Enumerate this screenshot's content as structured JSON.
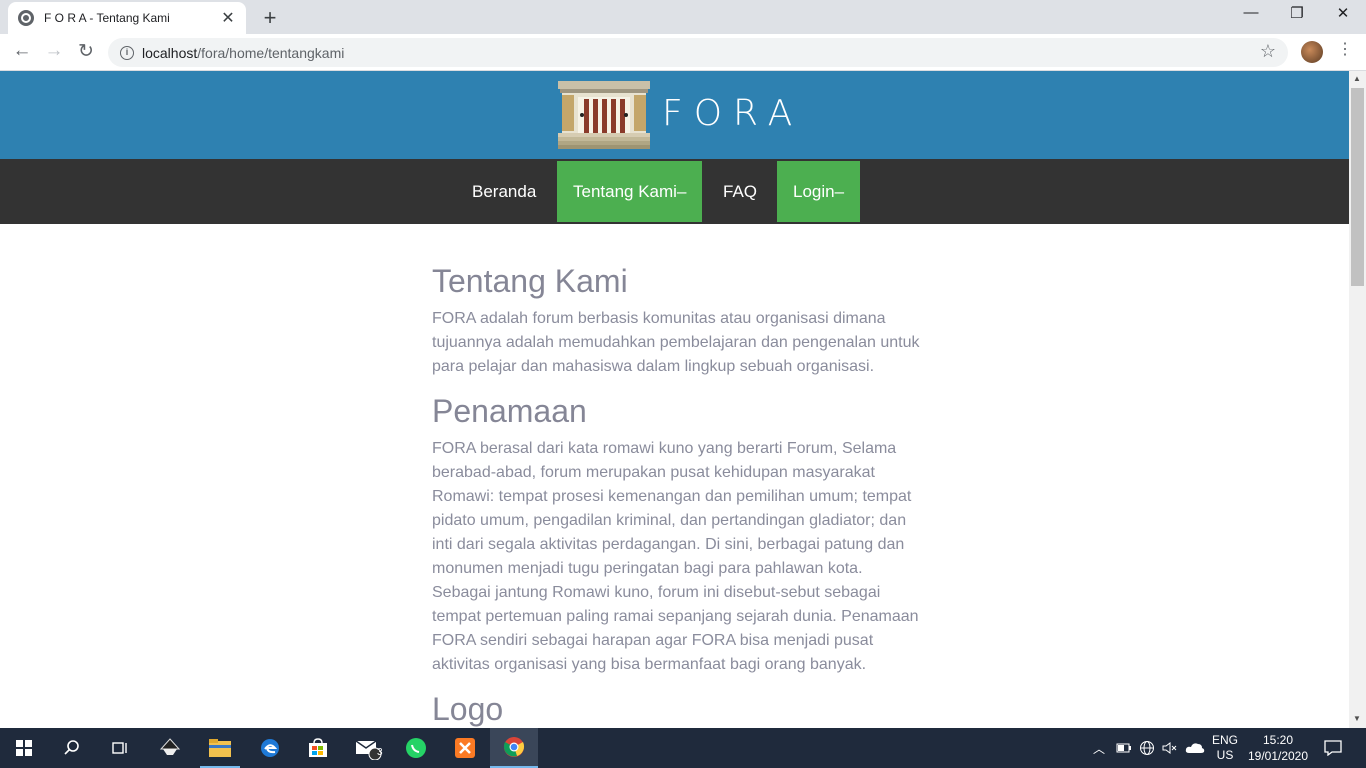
{
  "browser": {
    "tab_title": "F O R A - Tentang Kami",
    "url_host": "localhost",
    "url_path": "/fora/home/tentangkami"
  },
  "site": {
    "brand": "FORA",
    "nav": [
      {
        "label": "Beranda",
        "active": false
      },
      {
        "label": "Tentang Kami–",
        "active": true
      },
      {
        "label": "FAQ",
        "active": false
      },
      {
        "label": "Login–",
        "active": true
      }
    ],
    "colors": {
      "header": "#2e81b1",
      "nav": "#333333",
      "active": "#4caf50"
    }
  },
  "content": {
    "heading1": "Tentang Kami",
    "paragraph1": "FORA adalah forum berbasis komunitas atau organisasi dimana tujuannya adalah memudahkan pembelajaran dan pengenalan untuk para pelajar dan mahasiswa dalam lingkup sebuah organisasi.",
    "heading2": "Penamaan",
    "paragraph2": "FORA berasal dari kata romawi kuno yang berarti Forum, Selama berabad-abad, forum merupakan pusat kehidupan masyarakat Romawi: tempat prosesi kemenangan dan pemilihan umum; tempat pidato umum, pengadilan kriminal, dan pertandingan gladiator; dan inti dari segala aktivitas perdagangan. Di sini, berbagai patung dan monumen menjadi tugu peringatan bagi para pahlawan kota. Sebagai jantung Romawi kuno, forum ini disebut-sebut sebagai tempat pertemuan paling ramai sepanjang sejarah dunia. Penamaan FORA sendiri sebagai harapan agar FORA bisa menjadi pusat aktivitas organisasi yang bisa bermanfaat bagi orang banyak.",
    "heading3": "Logo"
  },
  "taskbar": {
    "mail_badge": "3",
    "lang_top": "ENG",
    "lang_bottom": "US",
    "time": "15:20",
    "date": "19/01/2020"
  }
}
